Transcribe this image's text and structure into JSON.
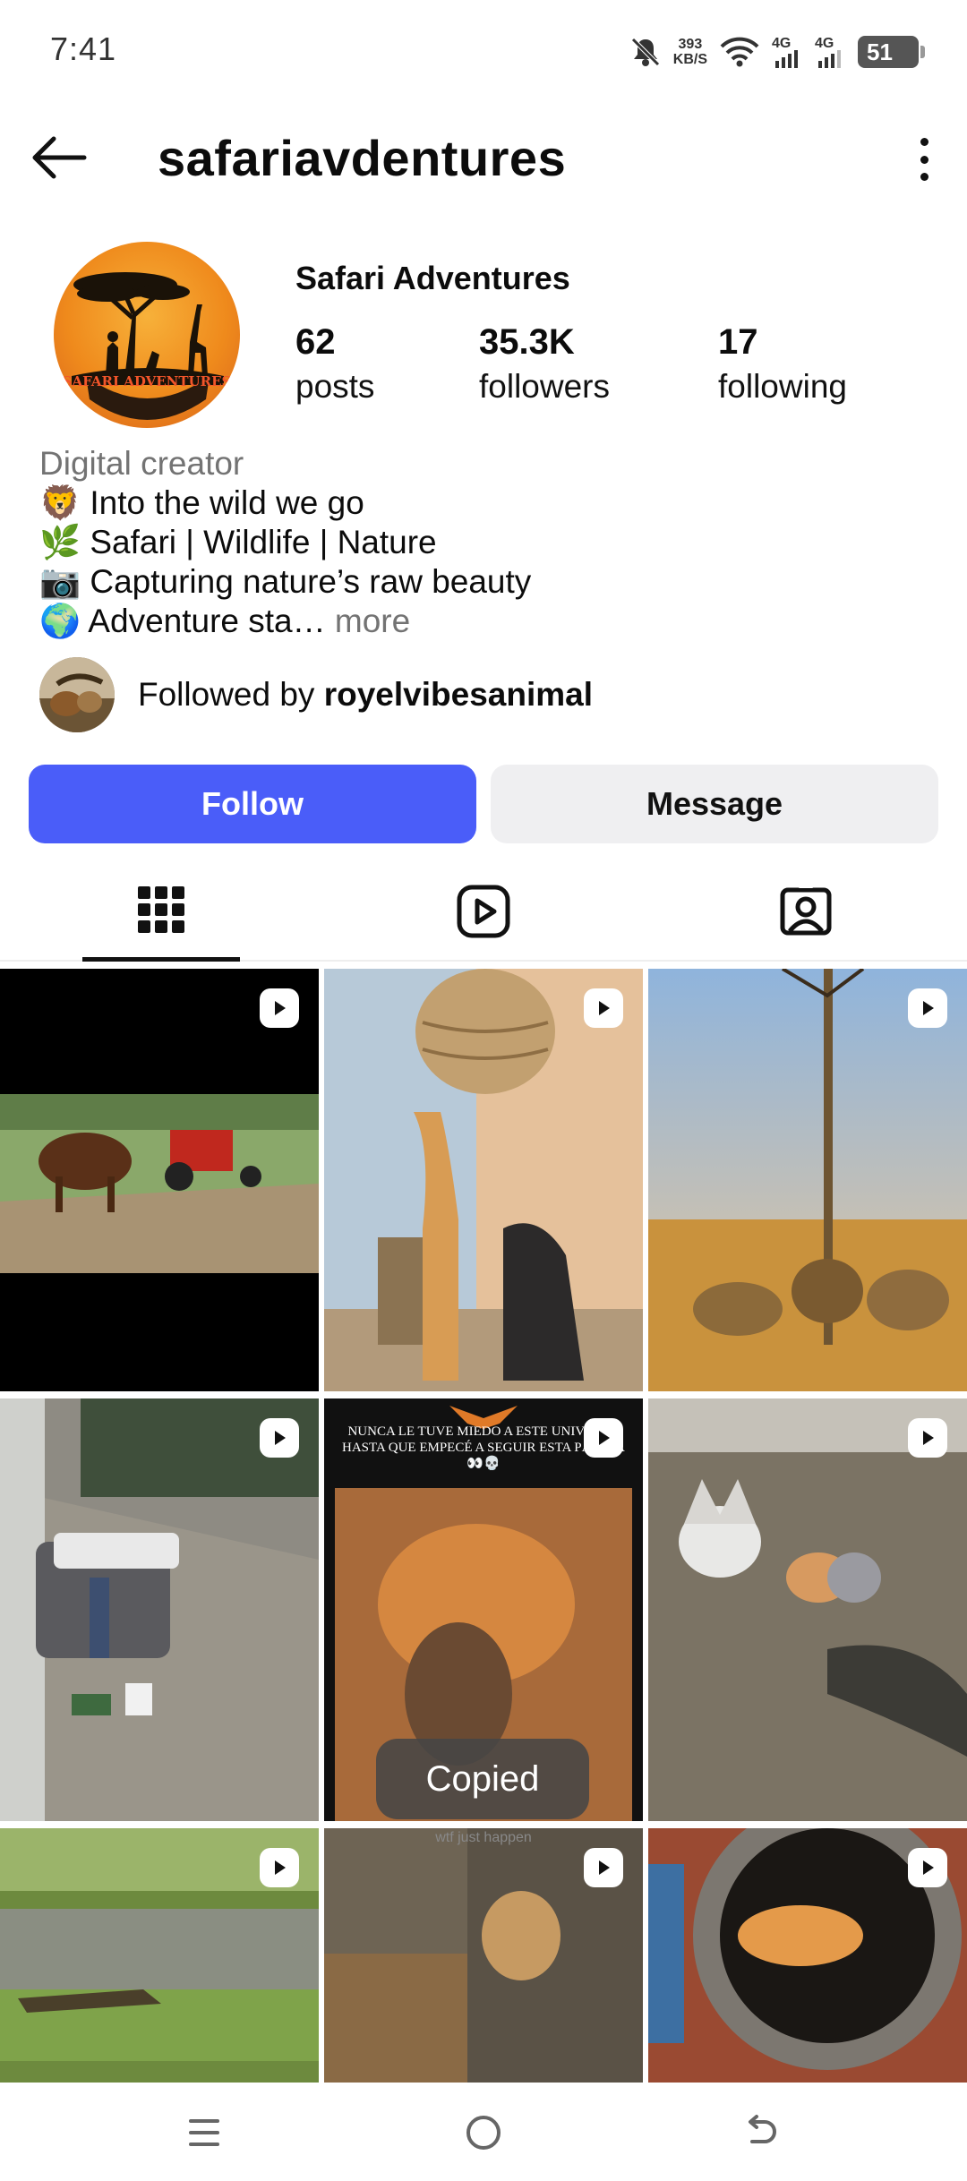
{
  "status": {
    "time": "7:41",
    "speed_value": "393",
    "speed_unit": "KB/S",
    "net1": "4G",
    "net2": "4G",
    "battery": "51"
  },
  "header": {
    "username": "safariavdentures"
  },
  "profile": {
    "display_name": "Safari Adventures",
    "logo_text": "SAFARI ADVENTURES",
    "stats": {
      "posts": {
        "value": "62",
        "label": "posts"
      },
      "followers": {
        "value": "35.3K",
        "label": "followers"
      },
      "following": {
        "value": "17",
        "label": "following"
      }
    },
    "category": "Digital creator",
    "bio_lines": [
      "🦁 Into the wild we go",
      "🌿 Safari | Wildlife | Nature",
      "📷 Capturing nature’s raw beauty",
      "🌍 Adventure sta…"
    ],
    "more_label": "more",
    "followed_by_prefix": "Followed by ",
    "followed_by_user": "royelvibesanimal"
  },
  "actions": {
    "follow": "Follow",
    "message": "Message"
  },
  "grid": {
    "post5_overlay": "NUNCA LE TUVE MIEDO A ESTE UNIVERSO HASTA QUE EMPECÉ A SEGUIR ESTA PÁGINA 👀💀",
    "post8_caption": "wtf just happen"
  },
  "toast": "Copied",
  "colors": {
    "accent": "#4a5df9",
    "secondary_button": "#efeff1",
    "muted_text": "#737373"
  }
}
